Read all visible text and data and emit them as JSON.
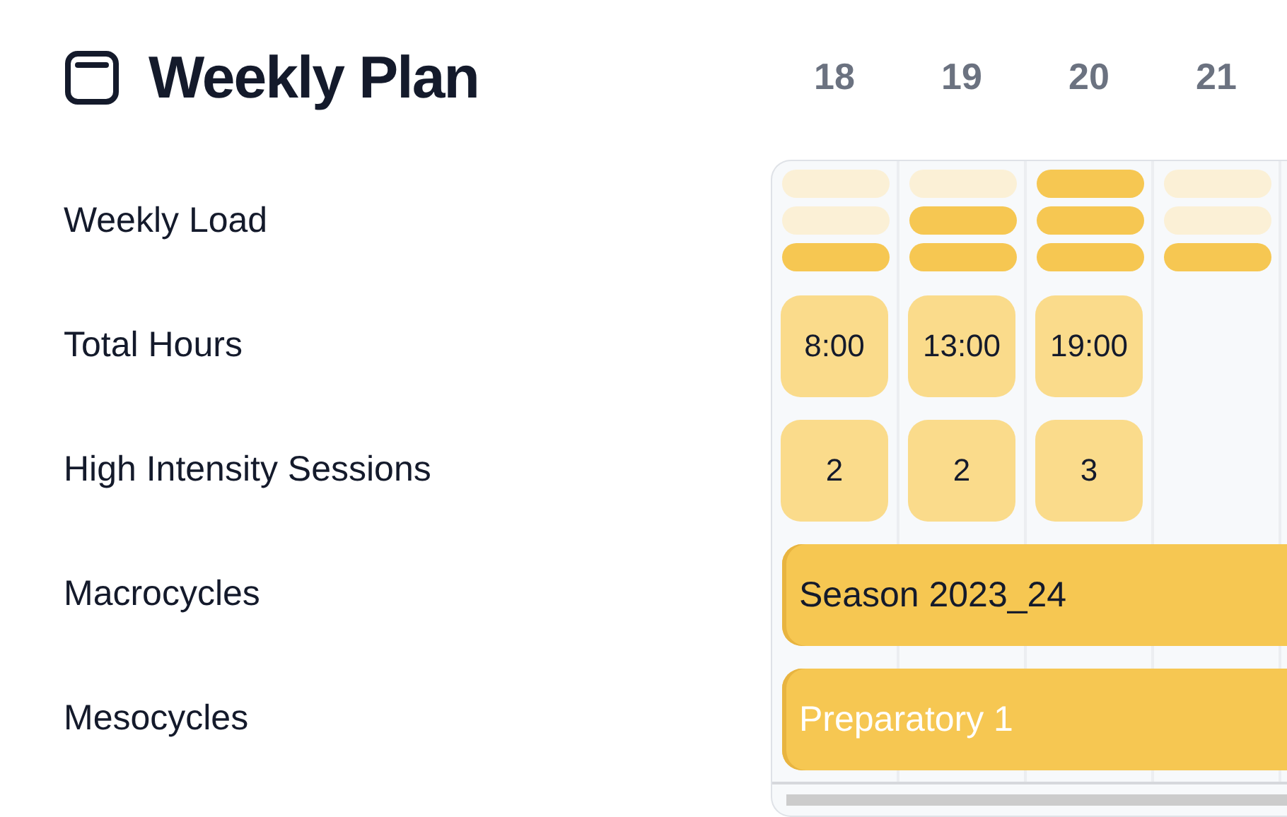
{
  "title": "Weekly Plan",
  "row_labels": [
    "Weekly Load",
    "Total Hours",
    "High Intensity Sessions",
    "Macrocycles",
    "Mesocycles"
  ],
  "weeks": [
    {
      "day": "18",
      "load": [
        false,
        false,
        true
      ],
      "hours": "8:00",
      "sessions": "2"
    },
    {
      "day": "19",
      "load": [
        false,
        true,
        true
      ],
      "hours": "13:00",
      "sessions": "2"
    },
    {
      "day": "20",
      "load": [
        true,
        true,
        true
      ],
      "hours": "19:00",
      "sessions": "3"
    },
    {
      "day": "21",
      "load": [
        false,
        false,
        true
      ]
    }
  ],
  "cycles": [
    {
      "kind": "macro",
      "label": "Season 2023_24"
    },
    {
      "kind": "meso",
      "label": "Preparatory 1"
    }
  ]
}
